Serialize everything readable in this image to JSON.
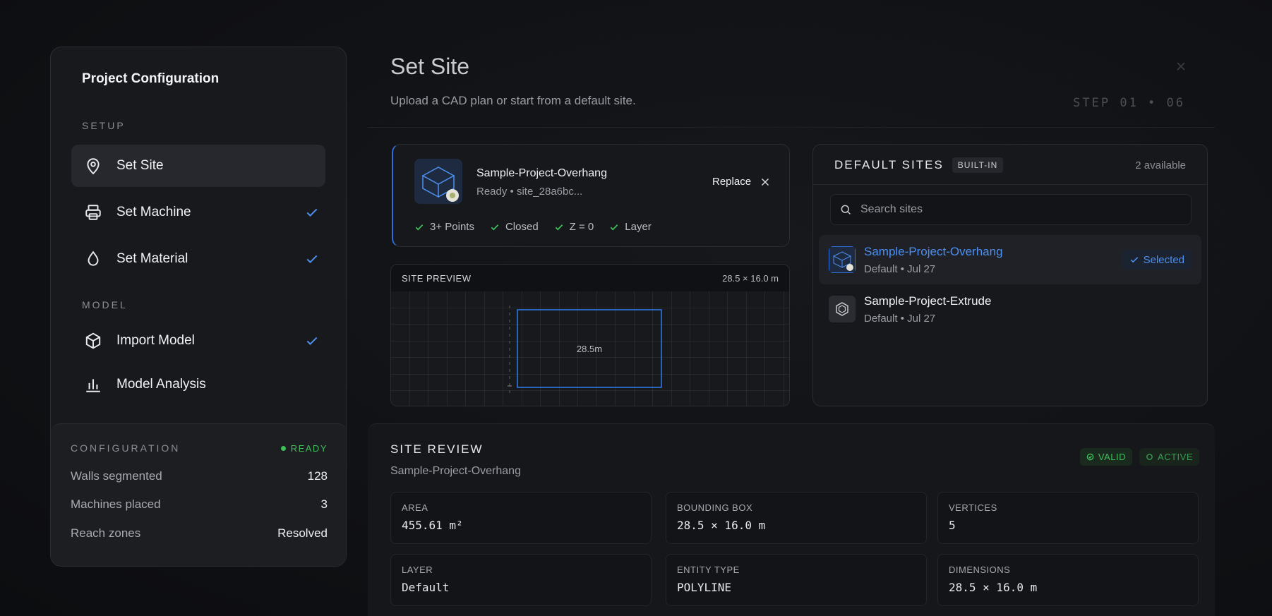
{
  "sidebar": {
    "title": "Project Configuration",
    "sections": [
      {
        "label": "SETUP"
      },
      {
        "label": "MODEL"
      }
    ],
    "items": [
      {
        "label": "Set Site",
        "icon": "map-pin-icon",
        "active": true,
        "done": false
      },
      {
        "label": "Set Machine",
        "icon": "printer-icon",
        "active": false,
        "done": true
      },
      {
        "label": "Set Material",
        "icon": "droplet-icon",
        "active": false,
        "done": true
      },
      {
        "label": "Import Model",
        "icon": "cube-icon",
        "active": false,
        "done": true
      },
      {
        "label": "Model Analysis",
        "icon": "bar-chart-icon",
        "active": false,
        "done": false
      }
    ],
    "config": {
      "title": "CONFIGURATION",
      "status": "READY",
      "rows": [
        {
          "key": "Walls segmented",
          "value": "128"
        },
        {
          "key": "Machines placed",
          "value": "3"
        },
        {
          "key": "Reach zones",
          "value": "Resolved"
        }
      ]
    }
  },
  "header": {
    "title": "Set Site",
    "subtitle": "Upload a CAD plan or start from a default site.",
    "step": "STEP 01 • 06"
  },
  "file": {
    "name": "Sample-Project-Overhang",
    "status": "Ready • site_28a6bc...",
    "replace_label": "Replace",
    "checks": [
      "3+ Points",
      "Closed",
      "Z = 0",
      "Layer"
    ]
  },
  "preview": {
    "title": "SITE PREVIEW",
    "dimensions": "28.5 × 16.0 m",
    "label": "28.5m"
  },
  "default_sites": {
    "title": "DEFAULT SITES",
    "badge": "BUILT-IN",
    "count": "2 available",
    "search_placeholder": "Search sites",
    "selected_label": "Selected",
    "sites": [
      {
        "name": "Sample-Project-Overhang",
        "meta": "Default • Jul 27"
      },
      {
        "name": "Sample-Project-Extrude",
        "meta": "Default • Jul 27"
      }
    ]
  },
  "review": {
    "title": "SITE REVIEW",
    "subtitle": "Sample-Project-Overhang",
    "badges": [
      "VALID",
      "ACTIVE"
    ],
    "tiles": [
      {
        "label": "AREA",
        "value": "455.61 m²"
      },
      {
        "label": "BOUNDING BOX",
        "value": "28.5 × 16.0 m"
      },
      {
        "label": "VERTICES",
        "value": "5"
      },
      {
        "label": "LAYER",
        "value": "Default"
      },
      {
        "label": "ENTITY TYPE",
        "value": "POLYLINE"
      },
      {
        "label": "DIMENSIONS",
        "value": "28.5 × 16.0 m"
      }
    ]
  },
  "colors": {
    "accent": "#4d90f0",
    "success": "#3fbf5a",
    "background": "#0f1013"
  }
}
